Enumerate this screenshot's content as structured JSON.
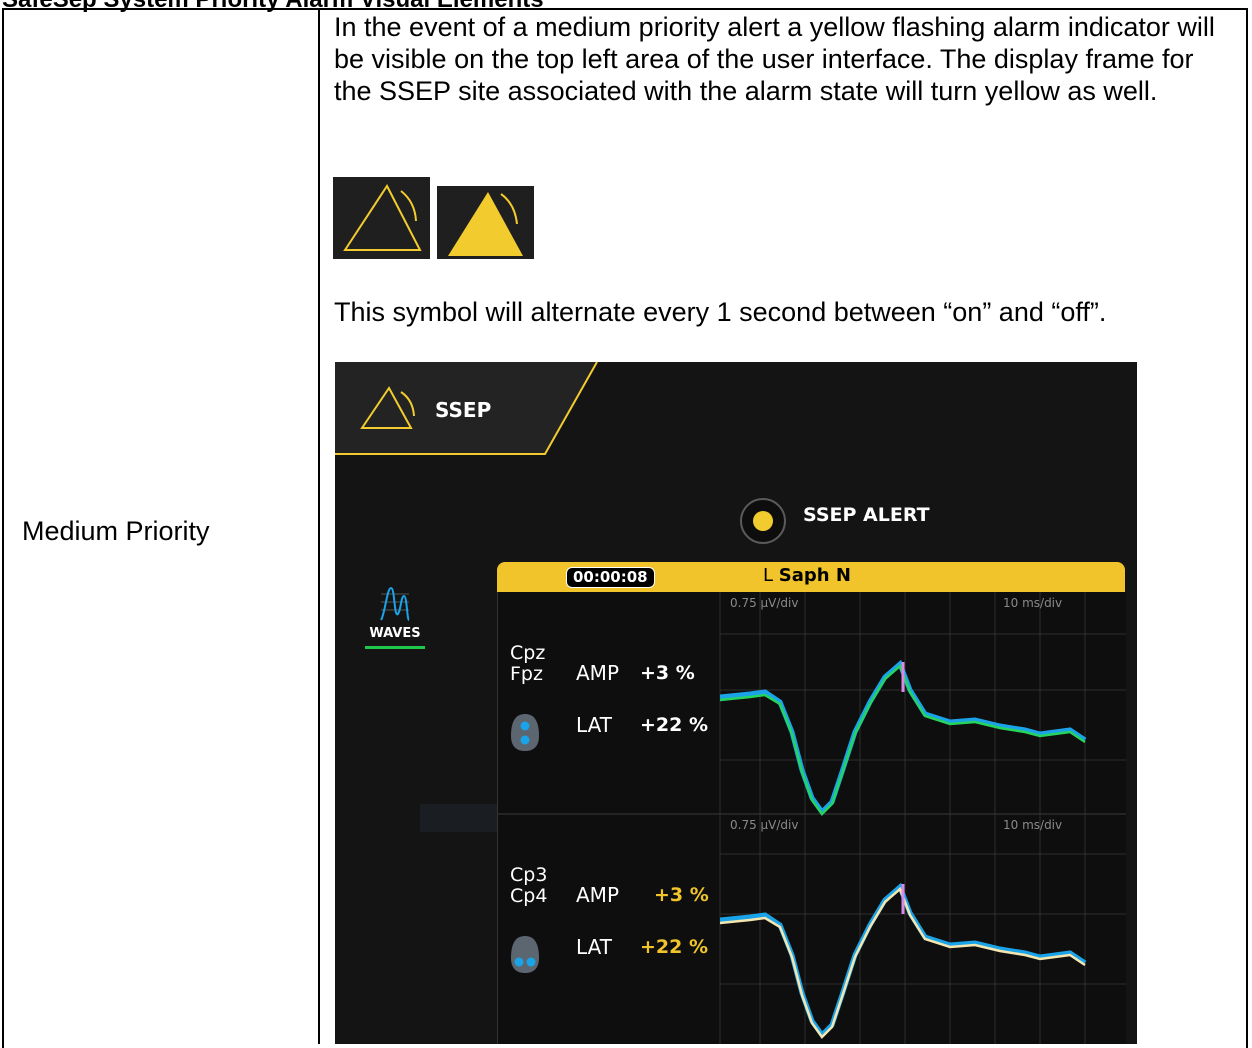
{
  "document": {
    "heading": "SafeSep System Priority Alarm Visual Elements",
    "row_label": "Medium Priority",
    "paragraph1": "In the event of a medium priority alert a yellow flashing alarm indicator will be visible on the top left area of the user interface. The display frame for the SSEP site associated with the alarm state will turn yellow as well.",
    "paragraph2": "This symbol will alternate every 1 second between “on” and “off”."
  },
  "symbols": [
    {
      "icon": "medium-priority-alarm-outline-icon",
      "state": "off"
    },
    {
      "icon": "medium-priority-alarm-filled-icon",
      "state": "on"
    }
  ],
  "screen": {
    "tab_label": "SSEP",
    "alert_label": "SSEP ALERT",
    "waves_label": "WAVES",
    "panel": {
      "timer": "00:00:08",
      "site_side": "L",
      "site_nerve": "Saph N",
      "channels": [
        {
          "name_top": "Cpz",
          "name_bottom": "Fpz",
          "amp_label": "AMP",
          "amp_value": "+3 %",
          "lat_label": "LAT",
          "lat_value": "+22 %",
          "scale_left": "0.75 µV/div",
          "scale_right": "10 ms/div"
        },
        {
          "name_top": "Cp3",
          "name_bottom": "Cp4",
          "amp_label": "AMP",
          "amp_value": "+3 %",
          "lat_label": "LAT",
          "lat_value": "+22 %",
          "scale_left": "0.75 µV/div",
          "scale_right": "10 ms/div"
        }
      ]
    },
    "colors": {
      "alarm_yellow": "#f2cc2e",
      "trace_blue": "#1aa3e8",
      "trace_green": "#26d35e",
      "trace_cream": "#f5e6b0",
      "marker_pink": "#d88ae6",
      "value_white": "#ffffff",
      "value_yellow": "#f0c42a"
    }
  }
}
